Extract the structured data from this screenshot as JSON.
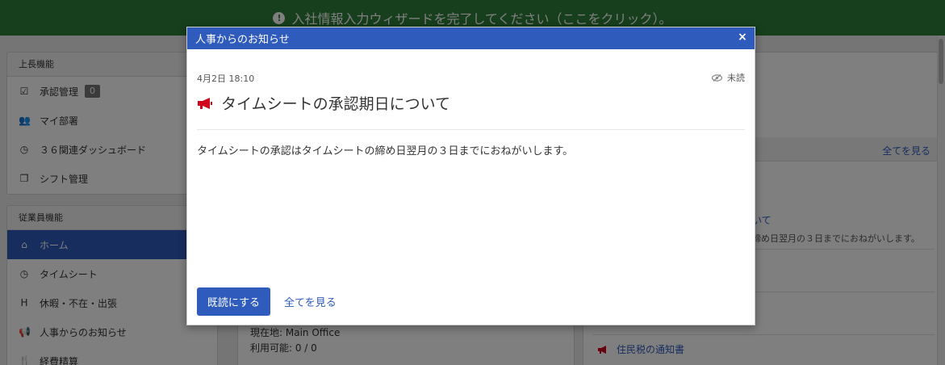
{
  "banner": {
    "text": "入社情報入力ウィザードを完了してください（ここをクリック）。"
  },
  "sidebar": {
    "manager_section": {
      "header": "上長機能",
      "items": [
        {
          "label": "承認管理",
          "badge": "0",
          "icon": "check-square-icon"
        },
        {
          "label": "マイ部署",
          "icon": "users-icon"
        },
        {
          "label": "３６関連ダッシュボード",
          "icon": "clock-icon"
        },
        {
          "label": "シフト管理",
          "icon": "copy-icon"
        }
      ]
    },
    "employee_section": {
      "header": "従業員機能",
      "items": [
        {
          "label": "ホーム",
          "icon": "home-icon",
          "active": true
        },
        {
          "label": "タイムシート",
          "icon": "clock-icon"
        },
        {
          "label": "休暇・不在・出張",
          "icon": "h-square-icon"
        },
        {
          "label": "人事からのお知らせ",
          "icon": "bullhorn-icon"
        },
        {
          "label": "経費精算",
          "icon": "cutlery-icon"
        }
      ]
    }
  },
  "center": {
    "location_text": "現在地: Main Office",
    "available_text": "利用可能: 0 / 0"
  },
  "right": {
    "view_all": "全てを見る",
    "partial_link": "いて",
    "partial_desc": "締め日翌月の３日までにおねがいします。",
    "tax_notice_title": "住民税の通知書"
  },
  "modal": {
    "header": "人事からのお知らせ",
    "close": "×",
    "date": "4月2日 18:10",
    "status": "未読",
    "title": "タイムシートの承認期日について",
    "body": "タイムシートの承認はタイムシートの締め日翌月の３日までにおねがいします。",
    "mark_read_button": "既読にする",
    "view_all_link": "全てを見る"
  },
  "colors": {
    "primary": "#2f5bbd",
    "banner_green": "#2e7d3a",
    "megaphone_red": "#d0021b"
  }
}
